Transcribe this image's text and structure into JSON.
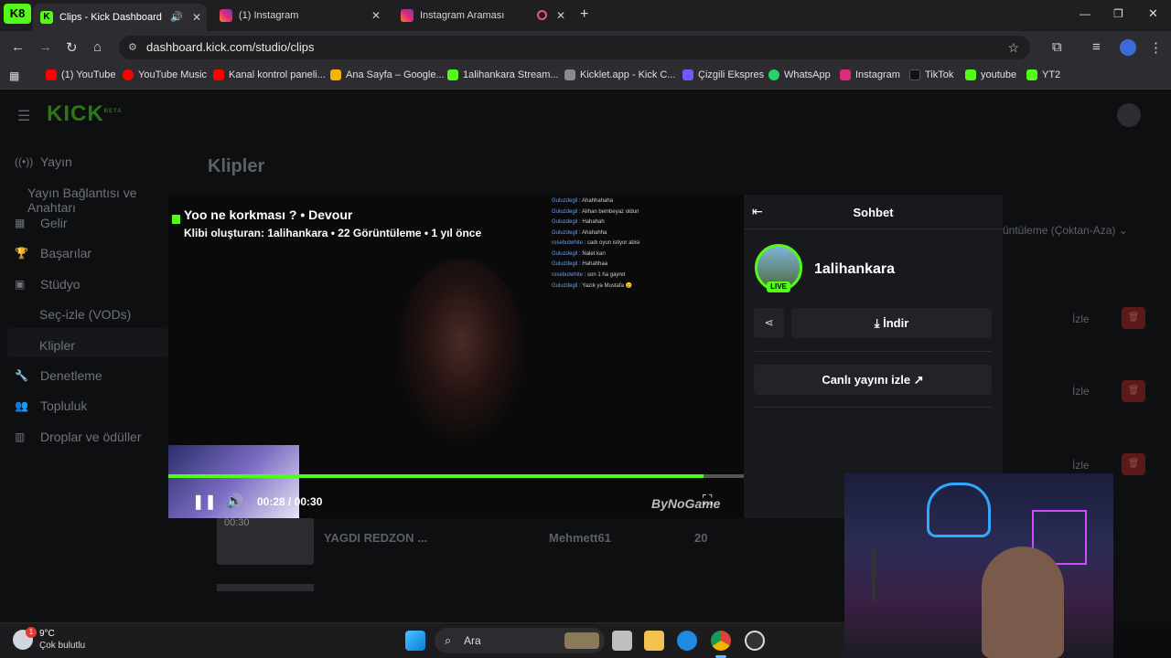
{
  "browser": {
    "tabs": [
      {
        "label": "Clips - Kick Dashboard",
        "active": true
      },
      {
        "label": "(1) Instagram",
        "active": false
      },
      {
        "label": "Instagram Araması",
        "active": false
      }
    ],
    "url": "dashboard.kick.com/studio/clips",
    "bookmarks": [
      {
        "label": "(1) YouTube",
        "color": "#ff0000"
      },
      {
        "label": "YouTube Music",
        "color": "#ff0000"
      },
      {
        "label": "Kanal kontrol paneli...",
        "color": "#ff0000"
      },
      {
        "label": "Ana Sayfa – Google...",
        "color": "#f4b400"
      },
      {
        "label": "1alihankara Stream...",
        "color": "#53fc18"
      },
      {
        "label": "Kicklet.app - Kick C...",
        "color": "#8a8a8a"
      },
      {
        "label": "Çizgili Ekspres",
        "color": "#6b5cff"
      },
      {
        "label": "WhatsApp",
        "color": "#25d366"
      },
      {
        "label": "Instagram",
        "color": "#dd2a7b"
      },
      {
        "label": "TikTok",
        "color": "#111111"
      },
      {
        "label": "youtube",
        "color": "#53fc18"
      },
      {
        "label": "YT2",
        "color": "#53fc18"
      }
    ]
  },
  "kick": {
    "logo": "KICK",
    "logo_badge": "BETA",
    "sidebar": {
      "items": [
        {
          "label": "Yayın",
          "icon": "broadcast-icon"
        },
        {
          "label": "Yayın Bağlantısı ve Anahtarı",
          "icon": ""
        },
        {
          "label": "Gelir",
          "icon": "revenue-icon"
        },
        {
          "label": "Başarılar",
          "icon": "trophy-icon"
        },
        {
          "label": "Stüdyo",
          "icon": "studio-icon"
        },
        {
          "label": "Seç-izle (VODs)",
          "icon": ""
        },
        {
          "label": "Klipler",
          "icon": ""
        },
        {
          "label": "Denetleme",
          "icon": "wrench-icon"
        },
        {
          "label": "Topluluk",
          "icon": "community-icon"
        },
        {
          "label": "Droplar ve ödüller",
          "icon": "drops-icon"
        }
      ]
    },
    "page_title": "Klipler",
    "sort_label": "üntüleme (Çoktan-Aza)",
    "watch_label": "İzle",
    "row": {
      "duration": "00:30",
      "title": "YAGDI REDZON ...",
      "creator": "Mehmett61",
      "views": "20"
    }
  },
  "player": {
    "title": "Yoo ne korkması ? • Devour",
    "subtitle": "Klibi oluşturan: 1alihankara • 22 Görüntüleme • 1 yıl önce",
    "progress": 0.93,
    "time": "00:28 / 00:30",
    "watermark": "ByNoGame",
    "chat_lines": [
      {
        "user": "Guluzdegil",
        "msg": "Ahahhahaha"
      },
      {
        "user": "Guluzdegil",
        "msg": "Alihan bembeyaz oldun"
      },
      {
        "user": "Guluzdegil",
        "msg": "Hahahah"
      },
      {
        "user": "Guluzdegil",
        "msg": "Ahahahha"
      },
      {
        "user": "rosebutwhite",
        "msg": "cadı oyun istiyor abisi"
      },
      {
        "user": "Guluzdegil",
        "msg": "Nalet karı"
      },
      {
        "user": "Guluzdegil",
        "msg": "Hahahhaa"
      },
      {
        "user": "rosebutwhite",
        "msg": "son 1 ha gayret"
      },
      {
        "user": "Guluzdegil",
        "msg": "Yazık ya Mustafa 😢"
      }
    ]
  },
  "chat": {
    "title": "Sohbet",
    "channel": "1alihankara",
    "live_label": "LIVE",
    "download_label": "İndir",
    "watch_live_label": "Canlı yayını izle"
  },
  "taskbar": {
    "weather_temp": "9°C",
    "weather_desc": "Çok bulutlu",
    "weather_badge": "1",
    "search_placeholder": "Ara"
  },
  "colors": {
    "kick_green": "#53fc18",
    "danger": "#5a1a1a"
  }
}
